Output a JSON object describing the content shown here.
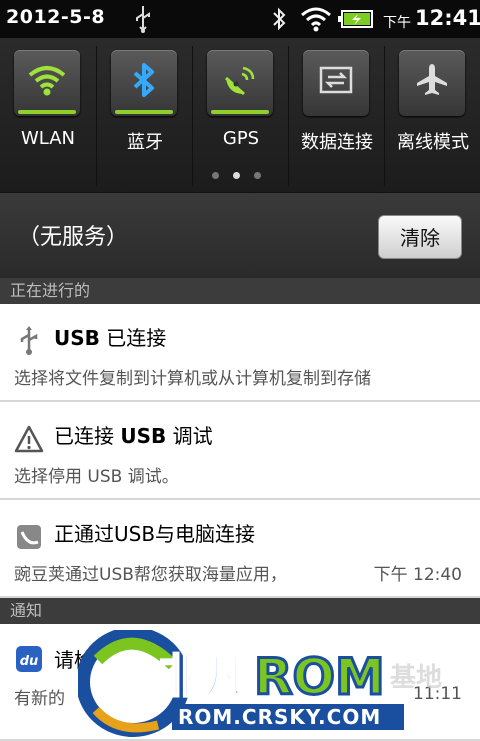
{
  "status_bar": {
    "date": "2012-5-8",
    "ampm": "下午",
    "time": "12:41",
    "icons": [
      "usb-icon",
      "bluetooth-icon",
      "wifi-icon",
      "battery-charging-icon"
    ]
  },
  "toggles": [
    {
      "label": "WLAN",
      "icon": "wifi-icon",
      "on": true
    },
    {
      "label": "蓝牙",
      "icon": "bluetooth-icon",
      "on": true
    },
    {
      "label": "GPS",
      "icon": "gps-icon",
      "on": true
    },
    {
      "label": "数据连接",
      "icon": "data-connection-icon",
      "on": false
    },
    {
      "label": "离线模式",
      "icon": "airplane-icon",
      "on": false
    }
  ],
  "pager": {
    "pages": 3,
    "current": 2
  },
  "carrier": "（无服务）",
  "clear_label": "清除",
  "sections": {
    "ongoing": "正在进行的",
    "notifications": "通知"
  },
  "ongoing": [
    {
      "icon": "usb-icon",
      "title_bold": "USB",
      "title_rest": " 已连接",
      "text": "选择将文件复制到计算机或从计算机复制到存储"
    },
    {
      "icon": "warning-icon",
      "title_pre": "已连接 ",
      "title_bold": "USB",
      "title_rest": " 调试",
      "text": "选择停用 USB 调试。"
    },
    {
      "icon": "wandoujia-icon",
      "title": "正通过USB与电脑连接",
      "text": "豌豆荚通过USB帮您获取海量应用，",
      "time": "下午 12:40"
    }
  ],
  "notifications": [
    {
      "icon": "du-app-icon",
      "title": "请检",
      "text": "有新的",
      "time": "11:11"
    }
  ],
  "watermark": {
    "brand_cn": "非凡",
    "brand_rom": "ROM",
    "url": "ROM.CRSKY.COM",
    "suffix": "基地"
  },
  "colors": {
    "toggle_on": "#8fcf2a",
    "watermark_blue": "#1a4fa0",
    "watermark_green": "#7cc520"
  }
}
